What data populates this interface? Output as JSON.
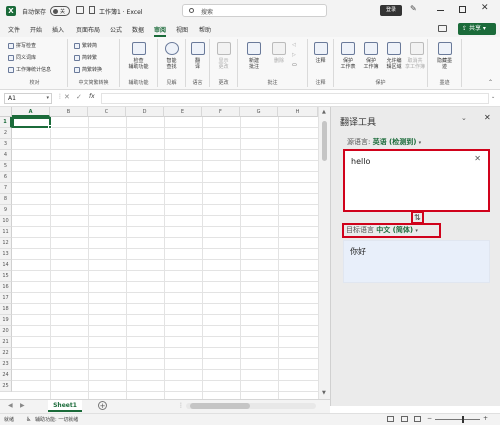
{
  "titlebar": {
    "autosave_label": "自动保存",
    "toggle_label": "关",
    "doc_title": "工作簿1 · Excel",
    "search_placeholder": "搜索",
    "login_label": "登录"
  },
  "tabs": [
    "文件",
    "开始",
    "插入",
    "页面布局",
    "公式",
    "数据",
    "审阅",
    "视图",
    "帮助"
  ],
  "active_tab": "审阅",
  "share_label": "共享",
  "ribbon": {
    "proof": {
      "items": [
        "拼写检查",
        "同义词库",
        "工作簿统计信息"
      ],
      "label": "校对"
    },
    "chinese": {
      "items": [
        "繁转简",
        "简转繁",
        "简繁转换"
      ],
      "label": "中文简繁转换"
    },
    "access": {
      "button": [
        "检查",
        "辅助功能"
      ],
      "label": "辅助功能"
    },
    "insight": {
      "button": [
        "智能",
        "查找"
      ],
      "label": "见解"
    },
    "language": {
      "button": [
        "翻",
        "译"
      ],
      "label": "语言"
    },
    "changes": {
      "button": [
        "显示",
        "更改"
      ],
      "label": "更改"
    },
    "comments": {
      "buttons": [
        [
          "新建",
          "批注"
        ],
        [
          "删除"
        ],
        [
          "上一条"
        ],
        [
          "下一条"
        ],
        [
          "显示",
          "批注"
        ]
      ],
      "label": "批注"
    },
    "notes": {
      "button": [
        "注释"
      ],
      "label": "注释"
    },
    "protect": {
      "buttons": [
        [
          "保护",
          "工作表"
        ],
        [
          "保护",
          "工作簿"
        ],
        [
          "允许编",
          "辑区域"
        ],
        [
          "取消共",
          "享工作簿"
        ]
      ],
      "label": "保护"
    },
    "hide": {
      "button": [
        "隐藏墨",
        "迹"
      ],
      "label": "墨迹"
    }
  },
  "formula": {
    "name_box": "A1",
    "fx": "fx"
  },
  "columns": [
    "A",
    "B",
    "C",
    "D",
    "E",
    "F",
    "G",
    "H"
  ],
  "rows": [
    "1",
    "2",
    "3",
    "4",
    "5",
    "6",
    "7",
    "8",
    "9",
    "10",
    "11",
    "12",
    "13",
    "14",
    "15",
    "16",
    "17",
    "18",
    "19",
    "20",
    "21",
    "22",
    "23",
    "24",
    "25"
  ],
  "sheet": {
    "name": "Sheet1"
  },
  "status": {
    "ready": "就绪",
    "accessibility": "辅助功能: 一切就绪"
  },
  "pane": {
    "title": "翻译工具",
    "source_label": "源语言:",
    "source_lang": "英语 (检测到)",
    "source_text": "hello",
    "target_label": "目标语言",
    "target_lang": "中文 (简体)",
    "target_text": "你好"
  },
  "colors": {
    "excel_green": "#1b6b3a",
    "highlight_red": "#d0021b"
  }
}
